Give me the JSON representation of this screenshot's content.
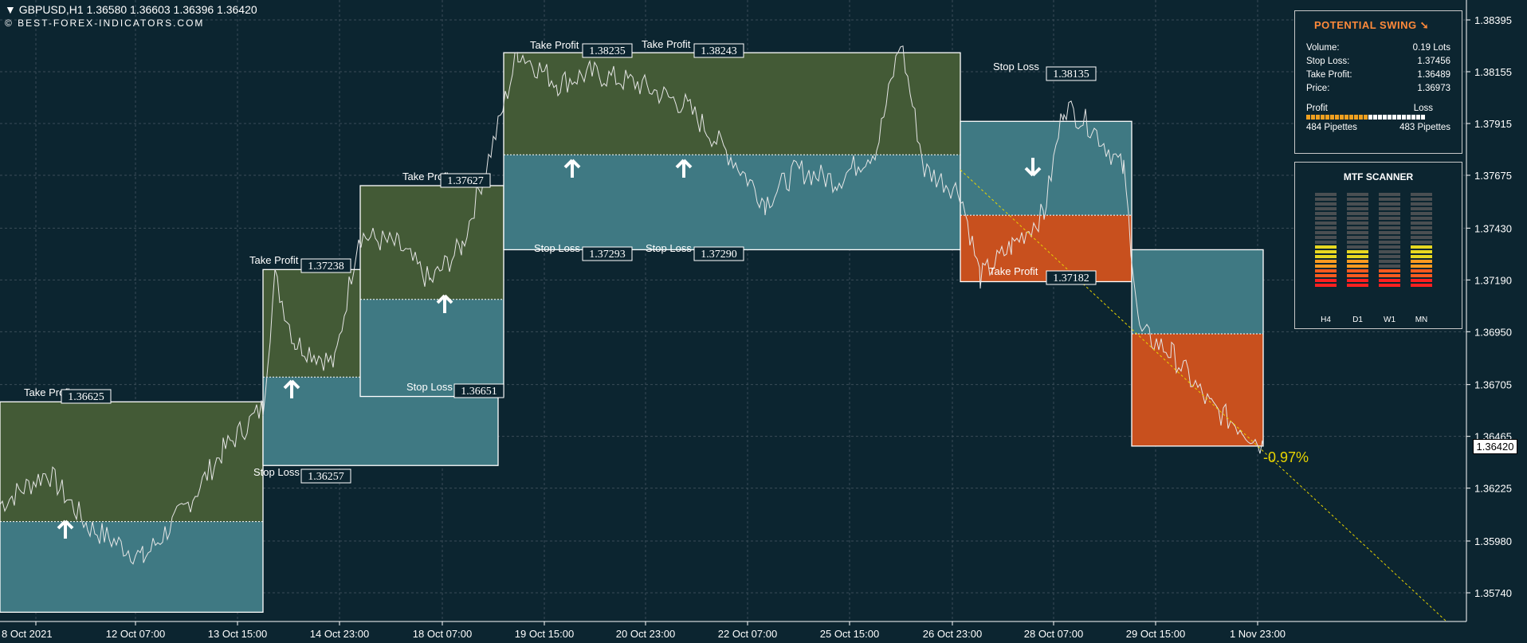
{
  "header": {
    "symbol_info": "GBPUSD,H1  1.36580 1.36603 1.36396 1.36420",
    "watermark": "© BEST-FOREX-INDICATORS.COM"
  },
  "potential_swing": {
    "title": "POTENTIAL SWING",
    "icon": "arrow-down-right-icon",
    "rows": [
      {
        "label": "Volume:",
        "value": "0.19 Lots"
      },
      {
        "label": "Stop Loss:",
        "value": "1.37456"
      },
      {
        "label": "Take Profit:",
        "value": "1.36489"
      },
      {
        "label": "Price:",
        "value": "1.36973"
      }
    ],
    "profit_label": "Profit",
    "loss_label": "Loss",
    "profit_fraction": 0.5,
    "profit_pips": "484 Pipettes",
    "loss_pips": "483 Pipettes"
  },
  "mtf_scanner": {
    "title": "MTF SCANNER",
    "columns": [
      {
        "label": "H4",
        "level": 9
      },
      {
        "label": "D1",
        "level": 8
      },
      {
        "label": "W1",
        "level": 4
      },
      {
        "label": "MN",
        "level": 9
      }
    ],
    "segments": 20
  },
  "current_price": "1.36420",
  "colors": {
    "background": "#0c2530",
    "profit_zone": "#435a36",
    "stop_zone": "#3f7983",
    "short_zone": "#c8501e",
    "grid": "#3a4c57",
    "arrow": "#ffffff",
    "forecast": "#e8d400",
    "swing_title": "#ff8a3a"
  },
  "chart_data": {
    "type": "line",
    "symbol": "GBPUSD",
    "timeframe": "H1",
    "x_tick_labels": [
      "8 Oct 2021",
      "12 Oct 07:00",
      "13 Oct 15:00",
      "14 Oct 23:00",
      "18 Oct 07:00",
      "19 Oct 15:00",
      "20 Oct 23:00",
      "22 Oct 07:00",
      "25 Oct 15:00",
      "26 Oct 23:00",
      "28 Oct 07:00",
      "29 Oct 15:00",
      "1 Nov 23:00"
    ],
    "y_tick_labels": [
      "1.38395",
      "1.38155",
      "1.37915",
      "1.37675",
      "1.37430",
      "1.37190",
      "1.36950",
      "1.36705",
      "1.36465",
      "1.36225",
      "1.35980",
      "1.35740"
    ],
    "ylim": [
      1.3562,
      1.3852
    ],
    "last_price": 1.3642,
    "forecast_label": "-0.97%",
    "zones": [
      {
        "kind": "long",
        "tp": 1.36625,
        "entry": 1.3607,
        "sl": 1.3565
      },
      {
        "kind": "long",
        "tp": 1.37238,
        "entry": 1.3674,
        "sl": 1.3633
      },
      {
        "kind": "long",
        "tp": 1.37627,
        "entry": 1.371,
        "sl": 1.3665
      },
      {
        "kind": "long",
        "tp": 1.38243,
        "entry": 1.3777,
        "sl": 1.3733
      },
      {
        "kind": "short",
        "tp": 1.37182,
        "entry": 1.3749,
        "sl": 1.37925
      },
      {
        "kind": "short",
        "tp": 1.3642,
        "entry": 1.3694,
        "sl": 1.3733
      }
    ],
    "labels": [
      {
        "text": "Take Profit",
        "value": "1.36625"
      },
      {
        "text": "Stop Loss",
        "value": "1.36257"
      },
      {
        "text": "Take Profit",
        "value": "1.37238"
      },
      {
        "text": "Stop Loss",
        "value": "1.36651"
      },
      {
        "text": "Take Profit",
        "value": "1.37627"
      },
      {
        "text": "Take Profit",
        "value": "1.38235"
      },
      {
        "text": "Take Profit",
        "value": "1.38243"
      },
      {
        "text": "Stop Loss",
        "value": "1.37293"
      },
      {
        "text": "Stop Loss",
        "value": "1.37290"
      },
      {
        "text": "Stop Loss",
        "value": "1.38135"
      },
      {
        "text": "Take Profit",
        "value": "1.37182"
      }
    ]
  }
}
